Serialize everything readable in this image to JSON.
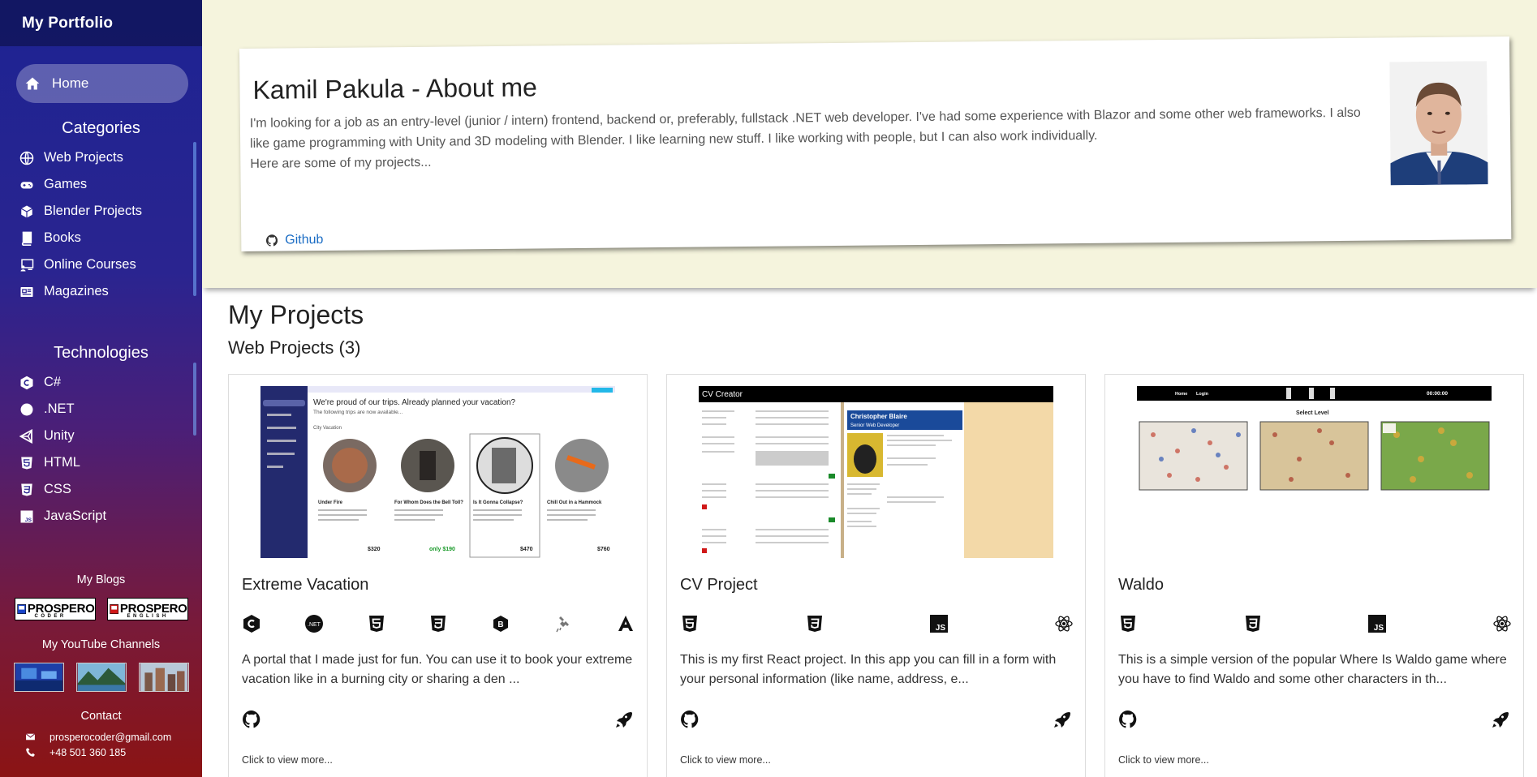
{
  "sidebar": {
    "brand": "My Portfolio",
    "home_label": "Home",
    "categories_title": "Categories",
    "categories": [
      {
        "label": "Web Projects",
        "icon": "globe-icon"
      },
      {
        "label": "Games",
        "icon": "gamepad-icon"
      },
      {
        "label": "Blender Projects",
        "icon": "cube-icon"
      },
      {
        "label": "Books",
        "icon": "book-icon"
      },
      {
        "label": "Online Courses",
        "icon": "chalkboard-icon"
      },
      {
        "label": "Magazines",
        "icon": "newspaper-icon"
      }
    ],
    "technologies_title": "Technologies",
    "technologies": [
      {
        "label": "C#",
        "icon": "csharp-icon"
      },
      {
        "label": ".NET",
        "icon": "dotnet-icon"
      },
      {
        "label": "Unity",
        "icon": "unity-icon"
      },
      {
        "label": "HTML",
        "icon": "html5-icon"
      },
      {
        "label": "CSS",
        "icon": "css3-icon"
      },
      {
        "label": "JavaScript",
        "icon": "js-icon"
      }
    ],
    "blogs_title": "My Blogs",
    "blogs": [
      {
        "name": "PROSPERO",
        "sub": "CODER",
        "color": "#1a44c8"
      },
      {
        "name": "PROSPERO",
        "sub": "ENGLISH",
        "color": "#d01818"
      }
    ],
    "youtube_title": "My YouTube Channels",
    "contact_title": "Contact",
    "contact_email": "prosperocoder@gmail.com",
    "contact_phone": "+48 501 360 185"
  },
  "about": {
    "title": "Kamil Pakula - About me",
    "paragraph": "I'm looking for a job as an entry-level (junior / intern) frontend, backend or, preferably, fullstack .NET web developer. I've had some experience with Blazor and some other web frameworks. I also like game programming with Unity and 3D modeling with Blender. I like learning new stuff. I like working with people, but I can also work individually.",
    "paragraph2": "Here are some of my projects...",
    "github_label": "Github"
  },
  "projects": {
    "title": "My Projects",
    "subtitle": "Web Projects (3)",
    "items": [
      {
        "title": "Extreme Vacation",
        "techs": [
          "csharp-icon",
          "dotnet-icon",
          "html5-icon",
          "css3-icon",
          "bootstrap-icon",
          "satellite-icon",
          "angular-icon"
        ],
        "description": "A portal that I made just for fun. You can use it to book your extreme vacation like in a burning city or sharing a den ...",
        "more": "Click to view more...",
        "shot": {
          "header": "We're proud of our trips. Already planned your vacation?",
          "subheader": "The following trips are now available...",
          "section": "City Vacation",
          "app_name": "Extreme Vacation",
          "trips": [
            {
              "name": "Under Fire",
              "price": "$320"
            },
            {
              "name": "For Whom Does the Bell Toll?",
              "price": "only $190"
            },
            {
              "name": "Is It Gonna Collapse?",
              "price": "$470"
            },
            {
              "name": "Chill Out in a Hammock",
              "price": "$760"
            }
          ]
        }
      },
      {
        "title": "CV Project",
        "techs": [
          "html5-icon",
          "css3-icon",
          "js-icon",
          "react-icon"
        ],
        "description": "This is my first React project. In this app you can fill in a form with your personal information (like name, address, e...",
        "more": "Click to view more...",
        "shot": {
          "app_title": "CV Creator",
          "name": "Christopher Blaire",
          "role": "Senior Web Developer"
        }
      },
      {
        "title": "Waldo",
        "techs": [
          "html5-icon",
          "css3-icon",
          "js-icon",
          "react-icon"
        ],
        "description": "This is a simple version of the popular Where Is Waldo game where you have to find Waldo and some other characters in th...",
        "more": "Click to view more...",
        "shot": {
          "nav_home": "Home",
          "nav_login": "Login",
          "timer": "00:00:00",
          "select_level": "Select Level"
        }
      }
    ]
  },
  "colors": {
    "hero_bg": "#f5f4dd",
    "link": "#1a6cc4",
    "sidebar_top": "#1d2392",
    "sidebar_bottom": "#8b1414"
  }
}
